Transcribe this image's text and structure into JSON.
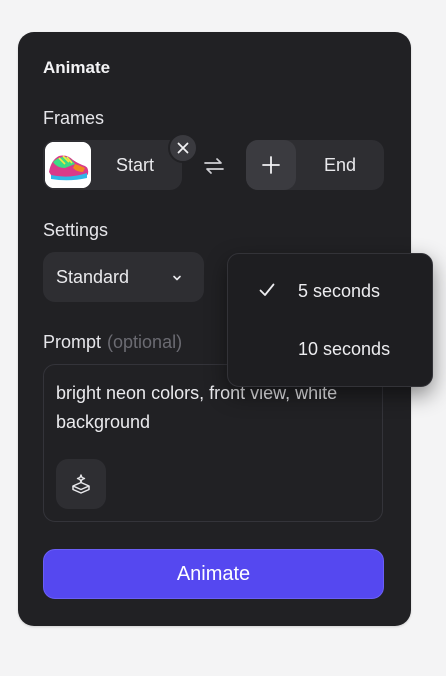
{
  "panel": {
    "title": "Animate"
  },
  "frames": {
    "label": "Frames",
    "start_label": "Start",
    "end_label": "End",
    "start_image": "sneaker-thumbnail",
    "remove_icon": "close-icon",
    "swap_icon": "swap-arrows-icon",
    "add_icon": "plus-icon"
  },
  "settings": {
    "label": "Settings",
    "quality_value": "Standard",
    "chevron_icon": "chevron-down-icon",
    "duration_options": [
      {
        "label": "5 seconds",
        "selected": true
      },
      {
        "label": "10 seconds",
        "selected": false
      }
    ]
  },
  "prompt": {
    "label": "Prompt",
    "optional_label": "(optional)",
    "value": "bright neon colors, front view, white background",
    "enhance_icon": "enhance-prompt-icon"
  },
  "actions": {
    "animate_label": "Animate"
  },
  "colors": {
    "panel_bg": "#212124",
    "accent": "#5548f0"
  }
}
